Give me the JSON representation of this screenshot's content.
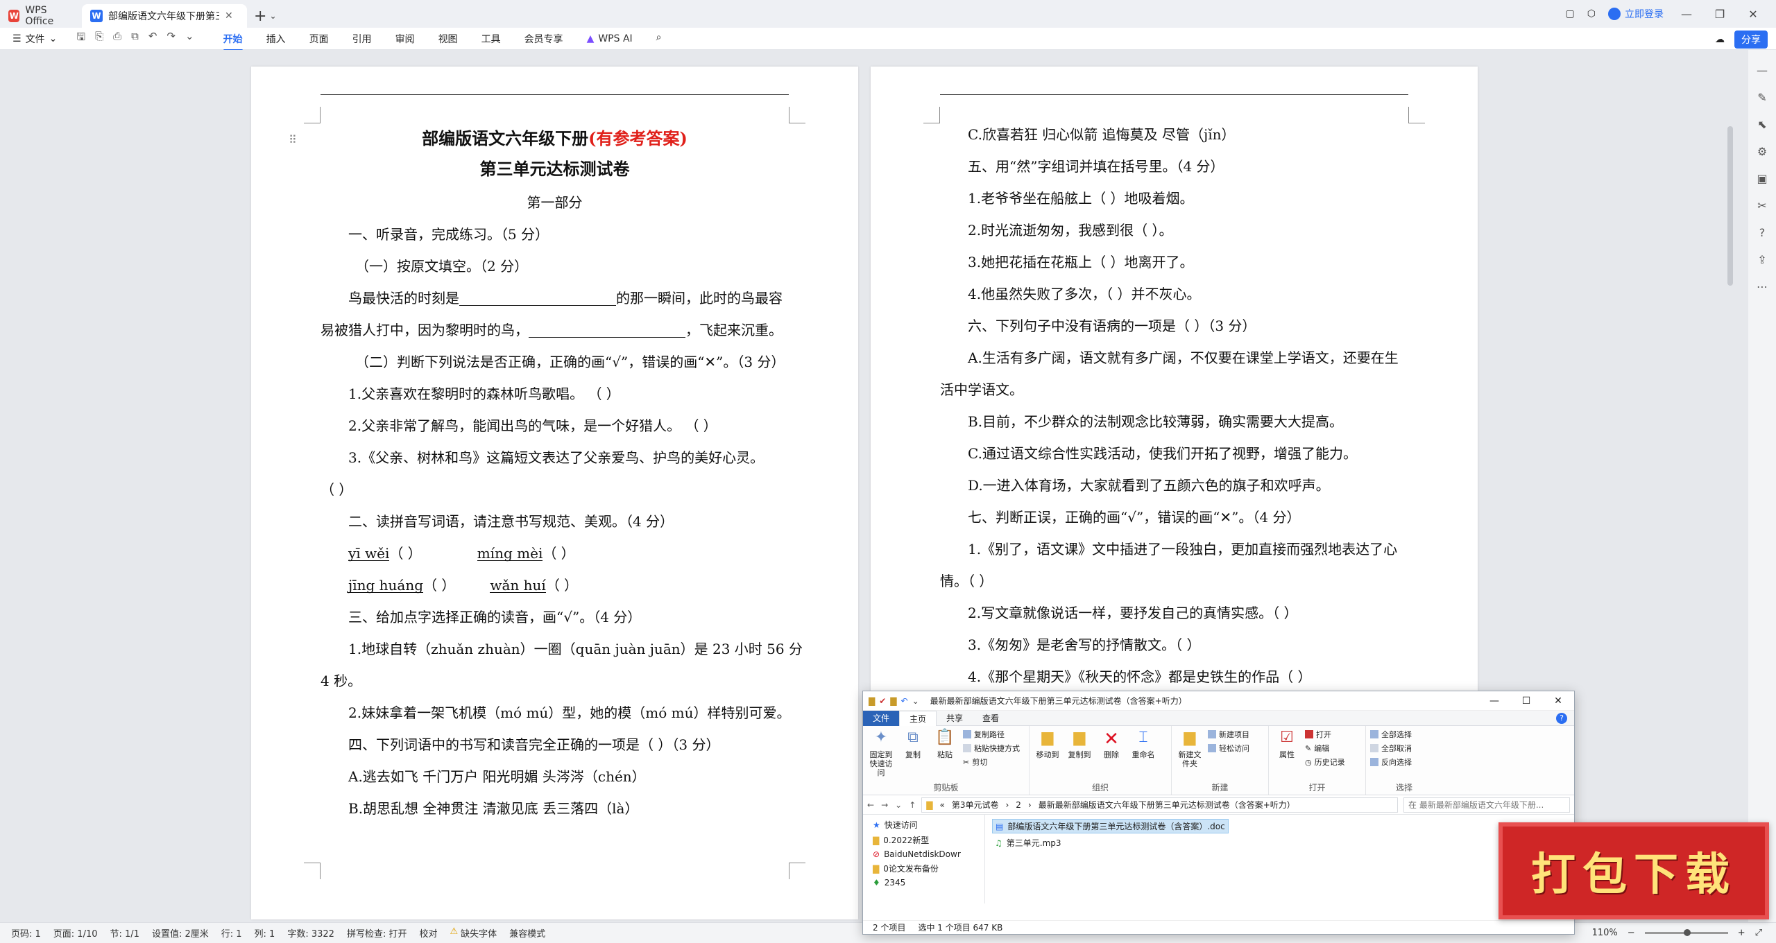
{
  "titlebar": {
    "home_tab": "WPS Office",
    "doc_tab": "部编版语文六年级下册第三单",
    "login": "立即登录"
  },
  "ribbon": {
    "file": "文件",
    "tabs": [
      "开始",
      "插入",
      "页面",
      "引用",
      "审阅",
      "视图",
      "工具",
      "会员专享"
    ],
    "active_tab": "开始",
    "wps_ai": "WPS AI",
    "share": "分享"
  },
  "page1": {
    "title_main": "部编版语文六年级下册",
    "title_red": "(有参考答案)",
    "subtitle": "第三单元达标测试卷",
    "part": "第一部分",
    "q1": "一、听录音，完成练习。（5 分）",
    "q1_1": "（一）按原文填空。（2 分）",
    "l1a": "鸟最快活的时刻是",
    "l1b": "的那一瞬间，此时的鸟最容",
    "l2a": "易被猎人打中，因为黎明时的鸟，",
    "l2b": "，飞起来沉重。",
    "q1_2": "（二）判断下列说法是否正确，正确的画“√”，错误的画“✕”。（3 分）",
    "j1": "1.父亲喜欢在黎明时的森林听鸟歌唱。  （    ）",
    "j2": "2.父亲非常了解鸟，能闻出鸟的气味，是一个好猎人。   （    ）",
    "j3": "3.《父亲、树林和鸟》这篇短文表达了父亲爱鸟、护鸟的美好心灵。",
    "j3b": "（    ）",
    "q2": "二、读拼音写词语，请注意书写规范、美观。（4 分）",
    "py1": "yī wěi",
    "py2": "míng mèi",
    "py3": "jīng huáng",
    "py4": "wǎn huí",
    "paren": "（           ）",
    "q3": "三、给加点字选择正确的读音，画“√”。（4 分）",
    "r1": "1.地球自转（zhuǎn  zhuàn）一圈（quān   juàn   juān）是 23 小时 56 分",
    "r1b": "4 秒。",
    "r2": "2.妹妹拿着一架飞机模（mó   mú）型，她的模（mó   mú）样特别可爱。",
    "q4": "四、下列词语中的书写和读音完全正确的一项是（    ）（3 分）",
    "a": "A.逃去如飞    千门万户    阳光明媚    头涔涔（chén）",
    "b": "B.胡思乱想    全神贯注    清澈见底    丢三落四（là）"
  },
  "page2": {
    "c": "C.欣喜若狂    归心似箭    追悔莫及    尽管（jǐn）",
    "q5": "五、用“然”字组词并填在括号里。（4 分）",
    "s1": "1.老爷爷坐在船舷上（          ）地吸着烟。",
    "s2": "2.时光流逝匆匆，我感到很（          ）。",
    "s3": "3.她把花插在花瓶上（          ）地离开了。",
    "s4": "4.他虽然失败了多次，（          ）并不灰心。",
    "q6": "六、下列句子中没有语病的一项是（    ）（3 分）",
    "a1": "A.生活有多广阔，语文就有多广阔，不仅要在课堂上学语文，还要在生",
    "a2": "活中学语文。",
    "b1": "B.目前，不少群众的法制观念比较薄弱，确实需要大大提高。",
    "c1": "C.通过语文综合性实践活动，使我们开拓了视野，增强了能力。",
    "d1": "D.一进入体育场，大家就看到了五颜六色的旗子和欢呼声。",
    "q7": "七、判断正误，正确的画“√”，错误的画“✕”。（4 分）",
    "t1": "1.《别了，语文课》文中插进了一段独白，更加直接而强烈地表达了心",
    "t1b": "情。（    ）",
    "t2": "2.写文章就像说话一样，要抒发自己的真情实感。（    ）",
    "t3": "3.《匆匆》是老舍写的抒情散文。（    ）",
    "t4": "4.《那个星期天》《秋天的怀念》都是史铁生的作品（    ）"
  },
  "statusbar": {
    "page": "页码: 1",
    "pages": "页面: 1/10",
    "section": "节: 1/1",
    "setting": "设置值: 2厘米",
    "row": "行: 1",
    "col": "列: 1",
    "words": "字数: 3322",
    "spell": "拼写检查: 打开",
    "proof": "校对",
    "missing_font": "缺失字体",
    "compat": "兼容模式",
    "zoom": "110%"
  },
  "explorer": {
    "title": "最新最新部编版语文六年级下册第三单元达标测试卷（含答案+听力）",
    "tabs": [
      "文件",
      "主页",
      "共享",
      "查看"
    ],
    "groups": {
      "clipboard": {
        "label": "剪贴板",
        "pin": "固定到快速访问",
        "copy": "复制",
        "paste": "粘贴",
        "copy_path": "复制路径",
        "paste_shortcut": "粘贴快捷方式",
        "cut": "剪切"
      },
      "organize": {
        "label": "组织",
        "move": "移动到",
        "copyto": "复制到",
        "delete": "删除",
        "rename": "重命名"
      },
      "new": {
        "label": "新建",
        "folder": "新建文件夹",
        "item": "新建项目",
        "easy": "轻松访问"
      },
      "open": {
        "label": "打开",
        "props": "属性",
        "open": "打开",
        "edit": "编辑",
        "history": "历史记录"
      },
      "select": {
        "label": "选择",
        "all": "全部选择",
        "none": "全部取消",
        "invert": "反向选择"
      }
    },
    "path": [
      "第3单元试卷",
      "2",
      "最新最新部编版语文六年级下册第三单元达标测试卷（含答案+听力）"
    ],
    "search": "在 最新最新部编版语文六年级下册...",
    "nav": [
      "快速访问",
      "0.2022新型",
      "BaiduNetdiskDowr",
      "0论文发布备份",
      "2345"
    ],
    "files": [
      "部编版语文六年级下册第三单元达标测试卷（含答案）.doc",
      "第三单元.mp3"
    ],
    "status_count": "2 个项目",
    "status_sel": "选中 1 个项目  647 KB"
  },
  "banner": "打包下载",
  "colors": {
    "accent": "#2b6ef2",
    "red": "#e0201a",
    "banner": "#cf2626"
  }
}
